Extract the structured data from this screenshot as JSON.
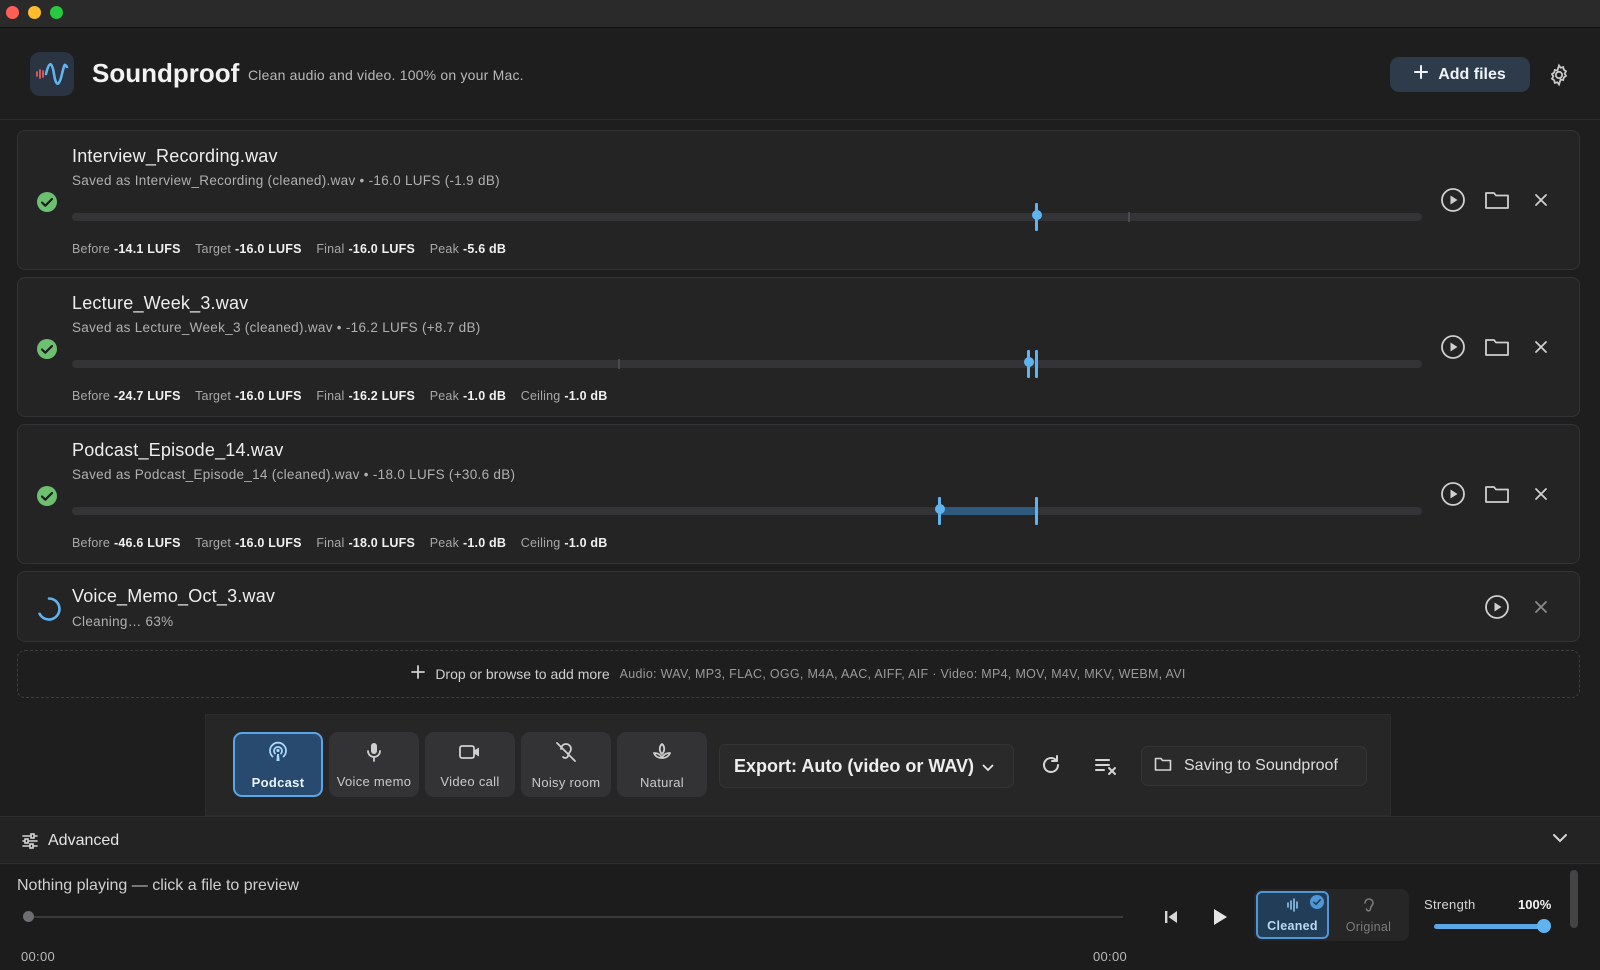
{
  "app": {
    "title": "Soundproof",
    "subtitle": "Clean audio and video. 100% on your Mac.",
    "add_files_label": "Add files"
  },
  "files": [
    {
      "name": "Interview_Recording.wav",
      "detail": "Saved as Interview_Recording (cleaned).wav • -16.0 LUFS (-1.9 dB)",
      "status": "done",
      "stats": [
        {
          "label": "Before",
          "value": "-14.1 LUFS"
        },
        {
          "label": "Target",
          "value": "-16.0 LUFS"
        },
        {
          "label": "Final",
          "value": "-16.0 LUFS"
        },
        {
          "label": "Peak",
          "value": "-5.6 dB"
        }
      ]
    },
    {
      "name": "Lecture_Week_3.wav",
      "detail": "Saved as Lecture_Week_3 (cleaned).wav • -16.2 LUFS (+8.7 dB)",
      "status": "done",
      "stats": [
        {
          "label": "Before",
          "value": "-24.7 LUFS"
        },
        {
          "label": "Target",
          "value": "-16.0 LUFS"
        },
        {
          "label": "Final",
          "value": "-16.2 LUFS"
        },
        {
          "label": "Peak",
          "value": "-1.0 dB"
        },
        {
          "label": "Ceiling",
          "value": "-1.0 dB"
        }
      ]
    },
    {
      "name": "Podcast_Episode_14.wav",
      "detail": "Saved as Podcast_Episode_14 (cleaned).wav • -18.0 LUFS (+30.6 dB)",
      "status": "done",
      "stats": [
        {
          "label": "Before",
          "value": "-46.6 LUFS"
        },
        {
          "label": "Target",
          "value": "-16.0 LUFS"
        },
        {
          "label": "Final",
          "value": "-18.0 LUFS"
        },
        {
          "label": "Peak",
          "value": "-1.0 dB"
        },
        {
          "label": "Ceiling",
          "value": "-1.0 dB"
        }
      ]
    },
    {
      "name": "Voice_Memo_Oct_3.wav",
      "detail": "Cleaning… 63%",
      "status": "processing",
      "progress": 0.63
    }
  ],
  "drop_zone": {
    "label": "Drop or browse to add more",
    "formats": "Audio: WAV, MP3, FLAC, OGG, M4A, AAC, AIFF, AIF · Video: MP4, MOV, M4V, MKV, WEBM, AVI"
  },
  "presets": [
    {
      "label": "Podcast",
      "icon": "podcast-icon",
      "active": true
    },
    {
      "label": "Voice memo",
      "icon": "microphone-icon",
      "active": false
    },
    {
      "label": "Video call",
      "icon": "video-camera-icon",
      "active": false
    },
    {
      "label": "Noisy room",
      "icon": "hearing-off-icon",
      "active": false
    },
    {
      "label": "Natural",
      "icon": "leaf-icon",
      "active": false
    }
  ],
  "export_label": "Export: Auto (video or WAV)",
  "saving_label": "Saving to Soundproof",
  "advanced_label": "Advanced",
  "player": {
    "status": "Nothing playing — click a file to preview",
    "time_current": "00:00",
    "time_total": "00:00",
    "mode_cleaned": "Cleaned",
    "mode_original": "Original",
    "strength_label": "Strength",
    "strength_value": "100%",
    "strength": 1.0
  },
  "colors": {
    "accent": "#5fb4f0",
    "success": "#6cc070",
    "background": "#1e1e1f"
  }
}
